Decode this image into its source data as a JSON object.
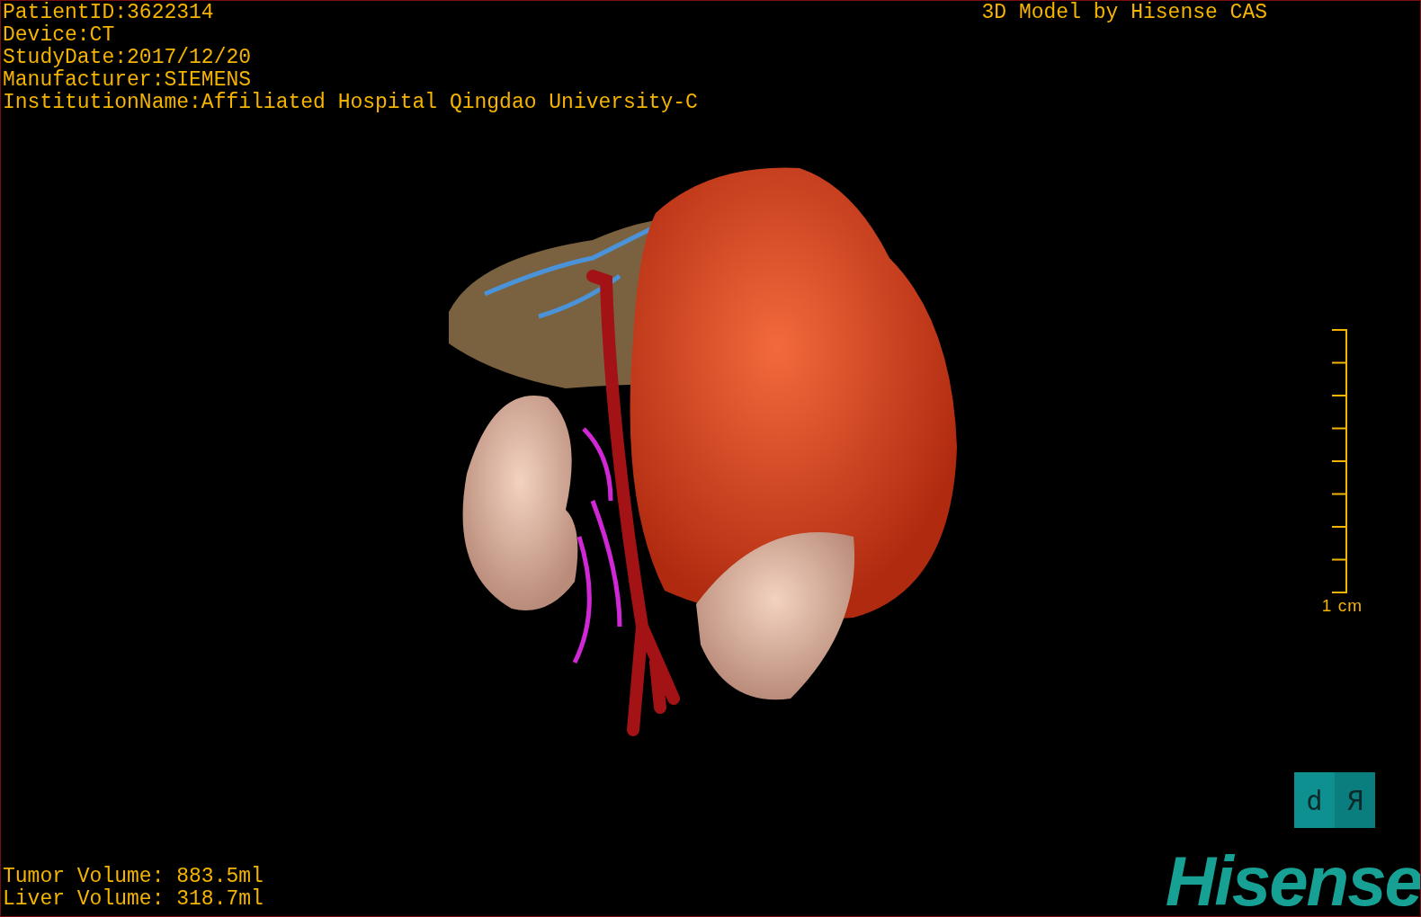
{
  "patient_info": [
    "PatientID:3622314",
    "Device:CT",
    "StudyDate:2017/12/20",
    "Manufacturer:SIEMENS",
    "InstitutionName:Affiliated Hospital Qingdao University-C"
  ],
  "title": "3D Model by Hisense CAS",
  "scale_bar": {
    "label": "1 cm"
  },
  "orientation_cube": {
    "faces": [
      {
        "label": "d",
        "kind": "front"
      },
      {
        "label": "Я",
        "kind": "side"
      }
    ]
  },
  "volumes": [
    "Tumor Volume: 883.5ml",
    "Liver Volume: 318.7ml"
  ],
  "logo": "Hisense"
}
